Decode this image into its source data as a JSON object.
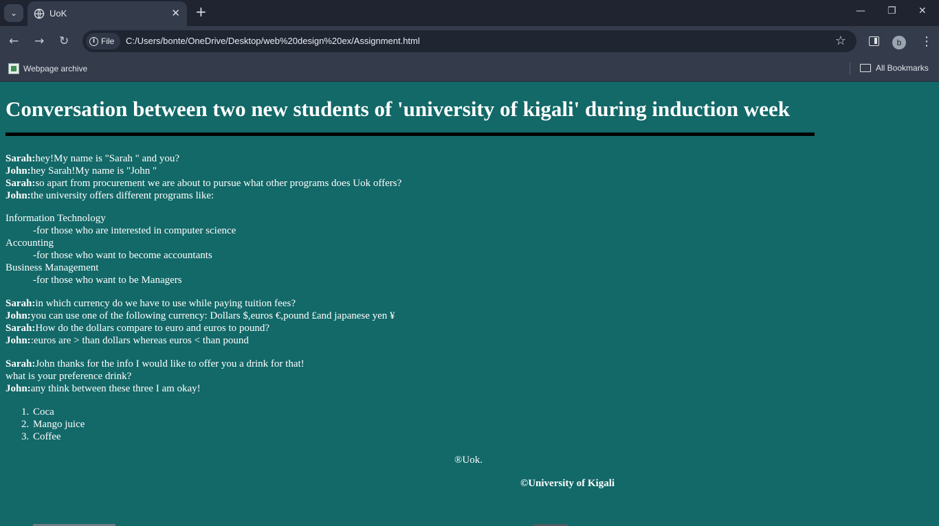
{
  "browser": {
    "tab_title": "UoK",
    "url_scheme_label": "File",
    "url": "C:/Users/bonte/OneDrive/Desktop/web%20design%20ex/Assignment.html",
    "profile_initial": "b",
    "bookmarks": [
      "Webpage archive"
    ],
    "all_bookmarks_label": "All Bookmarks"
  },
  "page": {
    "title": "Conversation between two new students of 'university of kigali' during induction week",
    "dialog1": [
      {
        "speaker": "Sarah:",
        "text": "hey!My name is \"Sarah \" and you?"
      },
      {
        "speaker": "John:",
        "text": "hey Sarah!My name is \"John \""
      },
      {
        "speaker": "Sarah:",
        "text": "so apart from procurement we are about to pursue what other programs does Uok offers?"
      },
      {
        "speaker": "John:",
        "text": "the university offers different programs like:"
      }
    ],
    "programs": [
      {
        "name": "Information Technology",
        "desc": "-for those who are interested in computer science"
      },
      {
        "name": "Accounting",
        "desc": "-for those who want to become accountants"
      },
      {
        "name": "Business Management",
        "desc": "-for those who want to be Managers"
      }
    ],
    "dialog2": [
      {
        "speaker": "Sarah:",
        "text": "in which currency do we have to use while paying tuition fees?"
      },
      {
        "speaker": "John:",
        "text": "you can use one of the following currency: Dollars $,euros €,pound £and japanese yen ¥"
      },
      {
        "speaker": "Sarah:",
        "text": "How do the dollars compare to euro and euros to pound?"
      },
      {
        "speaker": "John:",
        "text": ":euros are > than dollars whereas euros < than pound"
      }
    ],
    "dialog3": {
      "sarah_speaker": "Sarah:",
      "sarah_line1": "John thanks for the info I would like to offer you a drink for that!",
      "sarah_line2": "what is your preference drink?",
      "john_speaker": "John:",
      "john_line": "any think between these three I am okay!"
    },
    "drinks": [
      "Coca",
      "Mango juice",
      "Coffee"
    ],
    "footer_mark": "®Uok.",
    "footer_copyright": "©University of Kigali"
  }
}
